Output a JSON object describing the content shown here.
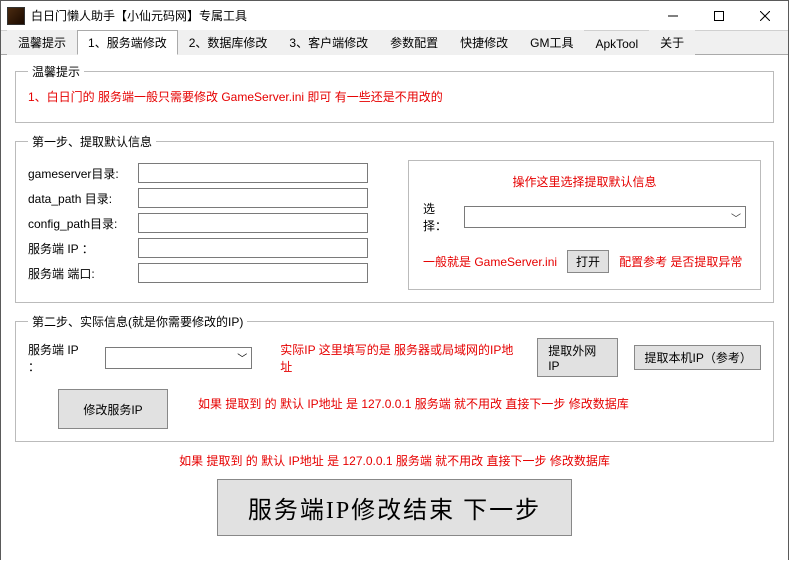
{
  "window": {
    "title": "白日门懒人助手【小仙元码网】专属工具"
  },
  "tabs": [
    "温馨提示",
    "1、服务端修改",
    "2、数据库修改",
    "3、客户端修改",
    "参数配置",
    "快捷修改",
    "GM工具",
    "ApkTool",
    "关于"
  ],
  "active_tab_index": 1,
  "tip_group": {
    "legend": "温馨提示",
    "line1": "1、白日门的 服务端一般只需要修改 GameServer.ini 即可 有一些还是不用改的"
  },
  "step1": {
    "legend": "第一步、提取默认信息",
    "fields": {
      "gameserver_label": "gameserver目录:",
      "gameserver_value": "",
      "data_path_label": "data_path 目录:",
      "data_path_value": "",
      "config_path_label": "config_path目录:",
      "config_path_value": "",
      "server_ip_label": "服务端 IP ：",
      "server_ip_value": "",
      "server_port_label": "服务端 端口:",
      "server_port_value": ""
    },
    "right": {
      "heading": "操作这里选择提取默认信息",
      "select_label": "选择：",
      "select_value": "",
      "hint_prefix": "一般就是 GameServer.ini",
      "open_btn": "打开",
      "hint_suffix": "配置参考  是否提取异常"
    }
  },
  "step2": {
    "legend": "第二步、实际信息(就是你需要修改的IP)",
    "server_ip_label": "服务端 IP ：",
    "server_ip_value": "",
    "real_ip_hint": "实际IP 这里填写的是 服务器或局域网的IP地址",
    "btn_wan": "提取外网IP",
    "btn_local": "提取本机IP（参考）",
    "btn_modify": "修改服务IP",
    "hint_line": "如果 提取到 的 默认 IP地址 是 127.0.0.1 服务端 就不用改 直接下一步 修改数据库"
  },
  "footer": {
    "hint_line": "如果 提取到 的 默认 IP地址 是 127.0.0.1 服务端 就不用改 直接下一步 修改数据库",
    "next_btn": "服务端IP修改结束 下一步"
  }
}
